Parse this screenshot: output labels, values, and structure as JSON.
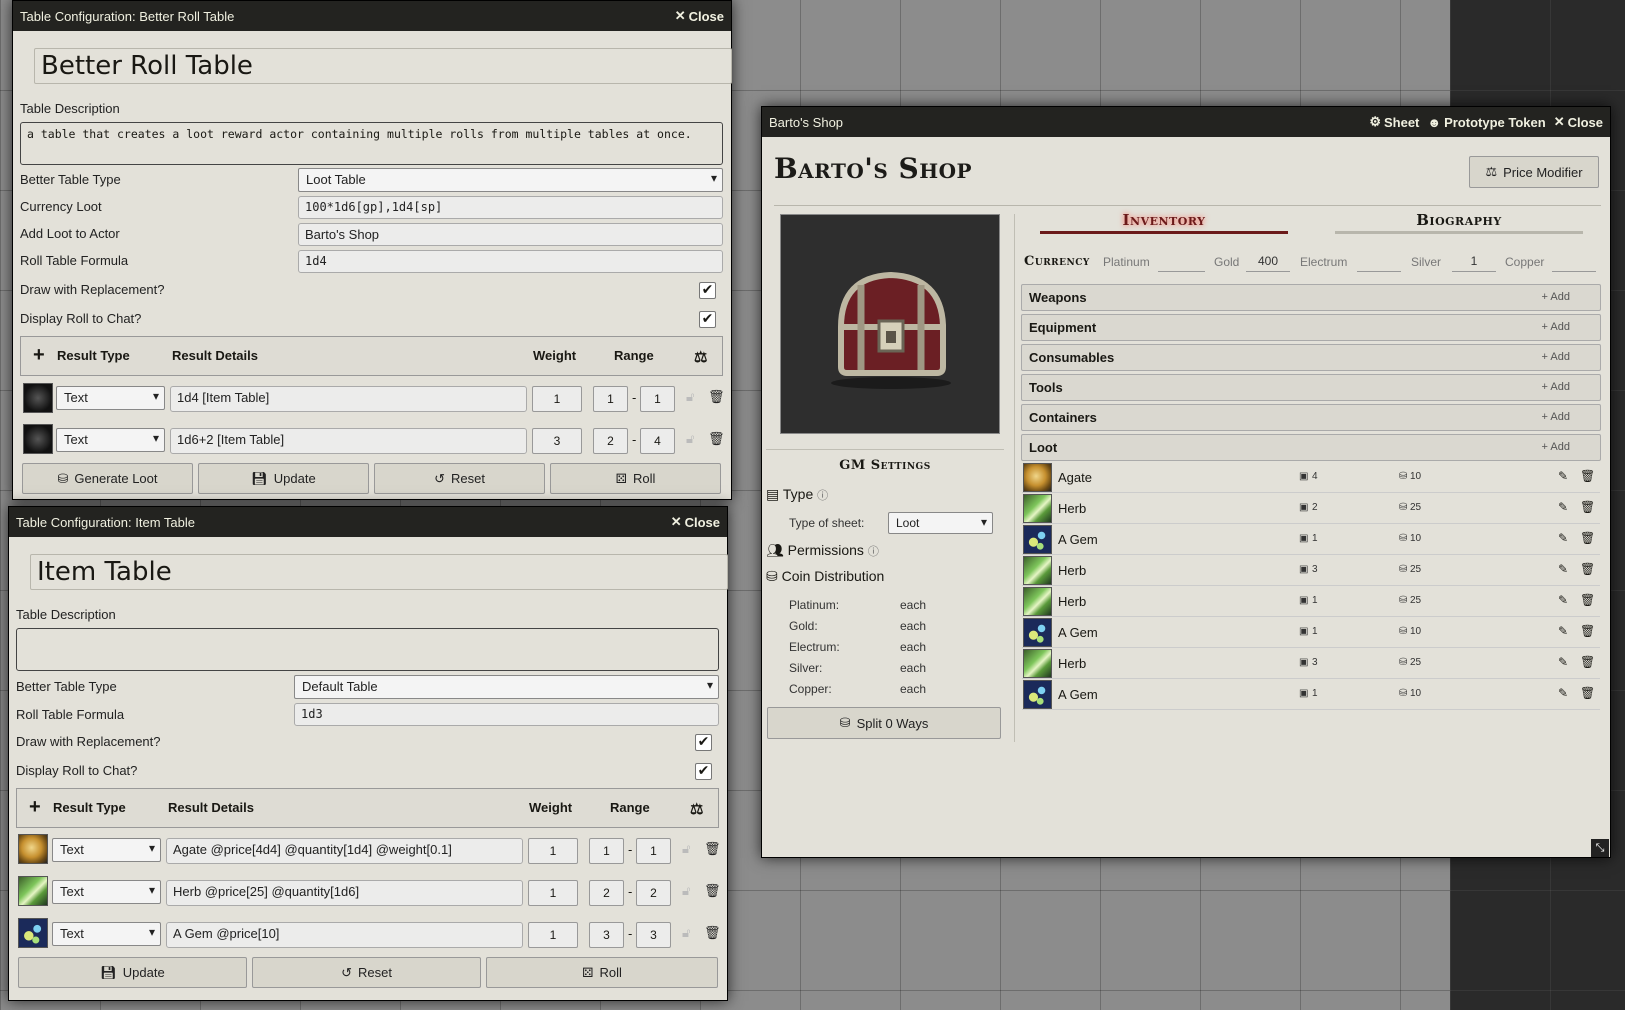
{
  "brt": {
    "title": "Table Configuration: Better Roll Table",
    "close": "Close",
    "name": "Better Roll Table",
    "desc_label": "Table Description",
    "desc": "a table that creates a loot reward actor containing multiple rolls from multiple tables at once.",
    "type_label": "Better Table Type",
    "type": "Loot Table",
    "currency_label": "Currency Loot",
    "currency": "100*1d6[gp],1d4[sp]",
    "actor_label": "Add Loot to Actor",
    "actor": "Barto's Shop",
    "formula_label": "Roll Table Formula",
    "formula": "1d4",
    "replacement_label": "Draw with Replacement?",
    "chat_label": "Display Roll to Chat?",
    "check": "✔",
    "col_type": "Result Type",
    "col_details": "Result Details",
    "col_weight": "Weight",
    "col_range": "Range",
    "rows": [
      {
        "type": "Text",
        "details": "1d4 [Item Table]",
        "weight": "1",
        "lo": "1",
        "hi": "1"
      },
      {
        "type": "Text",
        "details": "1d6+2 [Item Table]",
        "weight": "3",
        "lo": "2",
        "hi": "4"
      }
    ],
    "btn_generate": "Generate Loot",
    "btn_update": "Update",
    "btn_reset": "Reset",
    "btn_roll": "Roll"
  },
  "item": {
    "title": "Table Configuration: Item Table",
    "close": "Close",
    "name": "Item Table",
    "desc_label": "Table Description",
    "desc": "",
    "type_label": "Better Table Type",
    "type": "Default Table",
    "formula_label": "Roll Table Formula",
    "formula": "1d3",
    "replacement_label": "Draw with Replacement?",
    "chat_label": "Display Roll to Chat?",
    "col_type": "Result Type",
    "col_details": "Result Details",
    "col_weight": "Weight",
    "col_range": "Range",
    "rows": [
      {
        "type": "Text",
        "details": "Agate @price[4d4] @quantity[1d4] @weight[0.1]",
        "weight": "1",
        "lo": "1",
        "hi": "1"
      },
      {
        "type": "Text",
        "details": "Herb @price[25] @quantity[1d6]",
        "weight": "1",
        "lo": "2",
        "hi": "2"
      },
      {
        "type": "Text",
        "details": "A Gem @price[10]",
        "weight": "1",
        "lo": "3",
        "hi": "3"
      }
    ],
    "btn_update": "Update",
    "btn_reset": "Reset",
    "btn_roll": "Roll"
  },
  "shop": {
    "title": "Barto's Shop",
    "sheet": "Sheet",
    "proto": "Prototype Token",
    "close": "Close",
    "name": "Barto's Shop",
    "price_modifier": "Price Modifier",
    "tab_inventory": "Inventory",
    "tab_biography": "Biography",
    "currency_label": "Currency",
    "currency": [
      {
        "label": "Platinum",
        "value": ""
      },
      {
        "label": "Gold",
        "value": "400"
      },
      {
        "label": "Electrum",
        "value": ""
      },
      {
        "label": "Silver",
        "value": "1"
      },
      {
        "label": "Copper",
        "value": ""
      }
    ],
    "sections": [
      "Weapons",
      "Equipment",
      "Consumables",
      "Tools",
      "Containers",
      "Loot"
    ],
    "add": "Add",
    "items": [
      {
        "name": "Agate",
        "qty": "4",
        "price": "10",
        "img": "agate"
      },
      {
        "name": "Herb",
        "qty": "2",
        "price": "25",
        "img": "herb"
      },
      {
        "name": "A Gem",
        "qty": "1",
        "price": "10",
        "img": "gem"
      },
      {
        "name": "Herb",
        "qty": "3",
        "price": "25",
        "img": "herb"
      },
      {
        "name": "Herb",
        "qty": "1",
        "price": "25",
        "img": "herb"
      },
      {
        "name": "A Gem",
        "qty": "1",
        "price": "10",
        "img": "gem"
      },
      {
        "name": "Herb",
        "qty": "3",
        "price": "25",
        "img": "herb"
      },
      {
        "name": "A Gem",
        "qty": "1",
        "price": "10",
        "img": "gem"
      }
    ],
    "gm_settings": "GM Settings",
    "type_label": "Type",
    "type_of_sheet_label": "Type of sheet:",
    "type_of_sheet": "Loot",
    "permissions": "Permissions",
    "coin_distribution": "Coin Distribution",
    "coins": [
      {
        "label": "Platinum:",
        "value": "each"
      },
      {
        "label": "Gold:",
        "value": "each"
      },
      {
        "label": "Electrum:",
        "value": "each"
      },
      {
        "label": "Silver:",
        "value": "each"
      },
      {
        "label": "Copper:",
        "value": "each"
      }
    ],
    "split": "Split 0 Ways"
  }
}
